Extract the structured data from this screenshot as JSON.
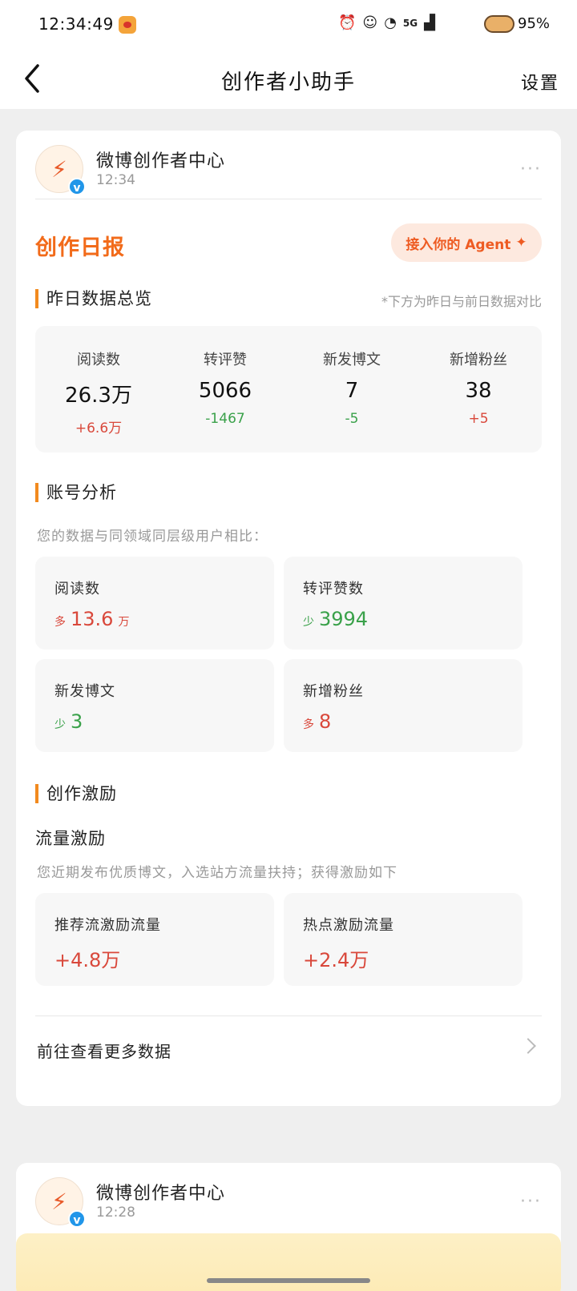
{
  "status_bar": {
    "time": "12:34:49",
    "signal": "5G",
    "battery": "95%"
  },
  "nav": {
    "title": "创作者小助手",
    "settings": "设置"
  },
  "messages": [
    {
      "sender": "微博创作者中心",
      "time": "12:34",
      "daily_title": "创作日报",
      "agent_button": "接入你的 Agent",
      "overview": {
        "title": "昨日数据总览",
        "note": "*下方为昨日与前日数据对比",
        "stats": [
          {
            "label": "阅读数",
            "value": "26.3万",
            "delta": "+6.6万",
            "trend": "up"
          },
          {
            "label": "转评赞",
            "value": "5066",
            "delta": "-1467",
            "trend": "down"
          },
          {
            "label": "新发博文",
            "value": "7",
            "delta": "-5",
            "trend": "down"
          },
          {
            "label": "新增粉丝",
            "value": "38",
            "delta": "+5",
            "trend": "up"
          }
        ]
      },
      "analysis": {
        "title": "账号分析",
        "subtitle": "您的数据与同领域同层级用户相比：",
        "tiles": [
          {
            "label": "阅读数",
            "prefix": "多",
            "value": "13.6",
            "unit": "万",
            "trend": "up"
          },
          {
            "label": "转评赞数",
            "prefix": "少",
            "value": "3994",
            "unit": "",
            "trend": "down"
          },
          {
            "label": "新发博文",
            "prefix": "少",
            "value": "3",
            "unit": "",
            "trend": "down"
          },
          {
            "label": "新增粉丝",
            "prefix": "多",
            "value": "8",
            "unit": "",
            "trend": "up"
          }
        ]
      },
      "incentive": {
        "title": "创作激励",
        "flow_title": "流量激励",
        "subtitle": "您近期发布优质博文，入选站方流量扶持；获得激励如下",
        "tiles": [
          {
            "label": "推荐流激励流量",
            "value": "+4.8万"
          },
          {
            "label": "热点激励流量",
            "value": "+2.4万"
          }
        ]
      },
      "more_link": "前往查看更多数据"
    },
    {
      "sender": "微博创作者中心",
      "time": "12:28"
    }
  ],
  "colors": {
    "accent_orange": "#f26b1a",
    "up_red": "#d9483b",
    "down_green": "#3aa14a"
  }
}
